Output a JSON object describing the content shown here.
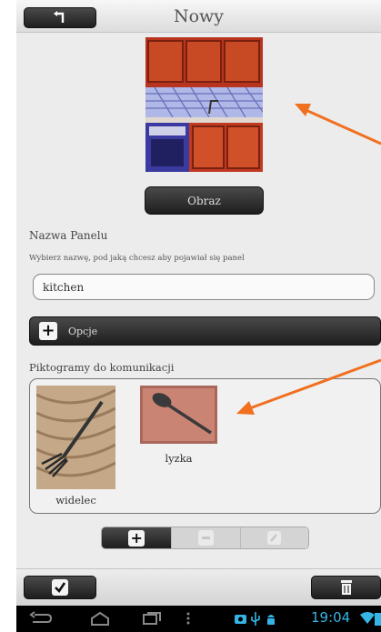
{
  "header": {
    "title": "Nowy",
    "back_icon": "back-arrow-icon"
  },
  "image_section": {
    "button_label": "Obraz",
    "image_subject": "kitchen"
  },
  "name_section": {
    "label": "Nazwa Panelu",
    "hint": "Wybierz nazwę, pod jaką chcesz aby pojawiał się panel",
    "input_value": "kitchen"
  },
  "options": {
    "label": "Opcje",
    "icon": "plus-icon"
  },
  "pictograms": {
    "label": "Piktogramy do komunikacji",
    "items": [
      {
        "caption": "widelec"
      },
      {
        "caption": "lyzka"
      }
    ]
  },
  "toolbar": {
    "add_icon": "plus-icon",
    "remove_icon": "minus-icon",
    "edit_icon": "edit-icon"
  },
  "bottom": {
    "confirm_icon": "checkmark-icon",
    "delete_icon": "trash-icon"
  },
  "system_bar": {
    "time": "19:04"
  },
  "colors": {
    "accent_arrow": "#f07020",
    "dark_button": "#2a2a2a",
    "clock": "#35b5e5"
  }
}
